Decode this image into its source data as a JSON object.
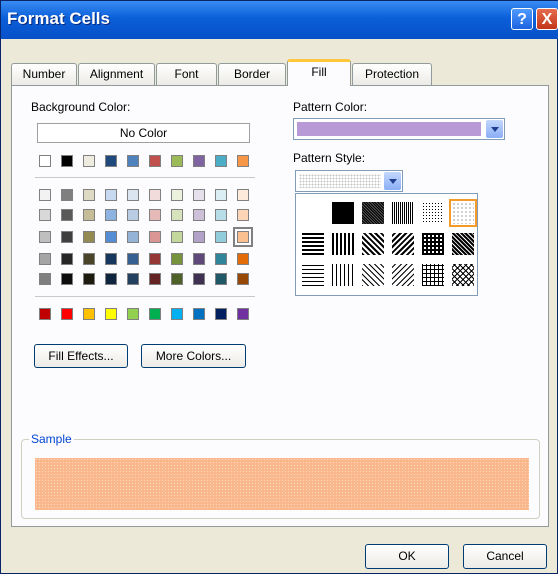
{
  "dialog": {
    "title": "Format Cells",
    "help_label": "?",
    "close_label": "X"
  },
  "tabs": [
    {
      "label": "Number",
      "active": false
    },
    {
      "label": "Alignment",
      "active": false
    },
    {
      "label": "Font",
      "active": false
    },
    {
      "label": "Border",
      "active": false
    },
    {
      "label": "Fill",
      "active": true
    },
    {
      "label": "Protection",
      "active": false
    }
  ],
  "background": {
    "label": "Background Color:",
    "no_color_label": "No Color",
    "standard_row": [
      "#ffffff",
      "#000000",
      "#eeece1",
      "#1f497d",
      "#4f81bd",
      "#c0504d",
      "#9bbb59",
      "#8064a2",
      "#4bacc6",
      "#f79646"
    ],
    "theme_grid": [
      [
        "#f2f2f2",
        "#7f7f7f",
        "#ddd9c3",
        "#c6d9f0",
        "#dbe5f1",
        "#f2dcdb",
        "#ebf1dd",
        "#e5e0ec",
        "#dbeef3",
        "#fdeada"
      ],
      [
        "#d8d8d8",
        "#595959",
        "#c4bd97",
        "#8db3e2",
        "#b8cce4",
        "#e5b9b7",
        "#d7e3bc",
        "#ccc1d9",
        "#b7dde8",
        "#fbd5b5"
      ],
      [
        "#bfbfbf",
        "#3f3f3f",
        "#938953",
        "#548dd4",
        "#95b3d7",
        "#d99694",
        "#c3d69b",
        "#b2a2c7",
        "#92cddc",
        "#fac08f"
      ],
      [
        "#a5a5a5",
        "#262626",
        "#494429",
        "#17365d",
        "#366092",
        "#953734",
        "#76923c",
        "#5f497a",
        "#31859b",
        "#e36c09"
      ],
      [
        "#7f7f7f",
        "#0c0c0c",
        "#1d1b10",
        "#0f243e",
        "#244061",
        "#632423",
        "#4f6128",
        "#3f3151",
        "#205867",
        "#974806"
      ]
    ],
    "recent_row": [
      "#c00000",
      "#ff0000",
      "#ffc000",
      "#ffff00",
      "#92d050",
      "#00b050",
      "#00b0f0",
      "#0070c0",
      "#002060",
      "#7030a0"
    ],
    "selected_color": "#fac08f"
  },
  "buttons": {
    "fill_effects": "Fill Effects...",
    "more_colors": "More Colors...",
    "ok": "OK",
    "cancel": "Cancel"
  },
  "pattern": {
    "color_label": "Pattern Color:",
    "color_value": "#b79ad6",
    "style_label": "Pattern Style:",
    "styles": [
      "none",
      "solid",
      "dark-gray",
      "medium-gray",
      "light-gray",
      "dotted",
      "horizontal-thick",
      "vertical-thick",
      "diagonal-down-thick",
      "diagonal-up-thick",
      "grid-thick",
      "dense-check",
      "horizontal-thin",
      "vertical-thin",
      "diagonal-down-thin",
      "diagonal-up-thin",
      "grid-thin",
      "crosshatch-thin"
    ],
    "selected_style": "dotted"
  },
  "sample": {
    "label": "Sample",
    "color": "#f9b78b"
  }
}
